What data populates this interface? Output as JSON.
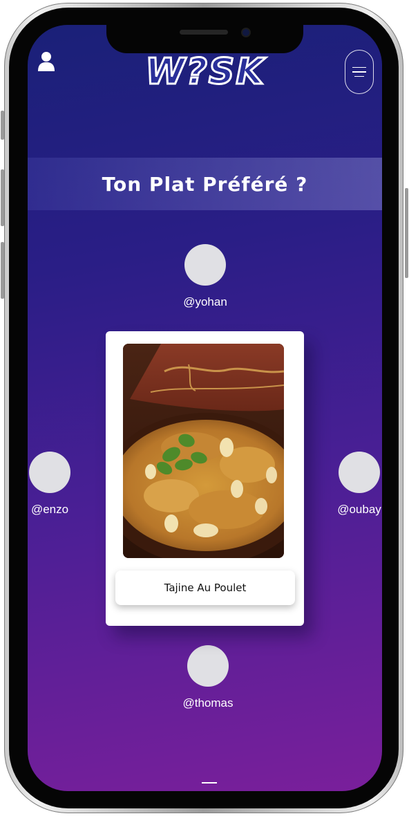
{
  "header": {
    "logo_text": "W?SK",
    "user_icon": "user-icon",
    "menu_icon": "hamburger-menu-icon"
  },
  "question": {
    "text": "Ton Plat Préféré ?"
  },
  "players": {
    "top": "@yohan",
    "left": "@enzo",
    "right": "@oubay",
    "bottom": "@thomas"
  },
  "card": {
    "dish_name": "Tajine Au Poulet",
    "image": "tajine-chicken-dish"
  },
  "colors": {
    "gradient_top": "#1a2078",
    "gradient_bottom": "#7a1f9b",
    "avatar": "#e0e0e4",
    "card_bg": "#ffffff"
  }
}
